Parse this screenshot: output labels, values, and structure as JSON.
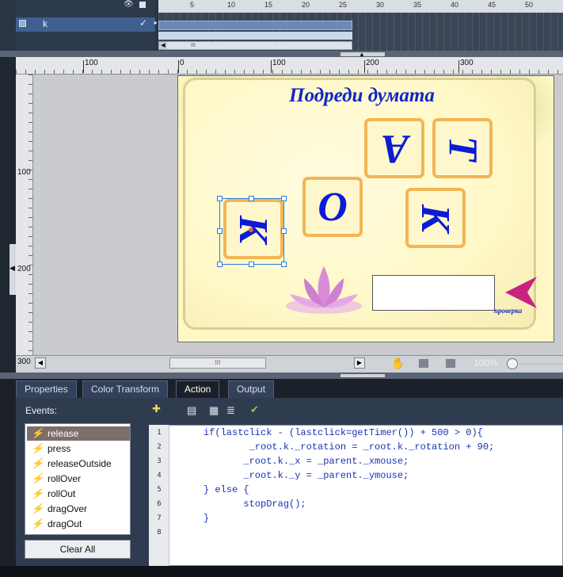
{
  "timeline": {
    "layer_name": "k",
    "ruler_numbers": [
      "5",
      "10",
      "15",
      "20",
      "25",
      "30",
      "35",
      "40",
      "45",
      "50"
    ],
    "scroll_label": "III"
  },
  "stage": {
    "ruler_top": [
      "100",
      "0",
      "100",
      "200",
      "300"
    ],
    "ruler_left": [
      "100",
      "200"
    ],
    "bottom_ruler": "300",
    "scroll_label": "III",
    "zoom": "100%"
  },
  "document": {
    "title": "Подреди думата",
    "tiles": [
      "К",
      "О",
      "А",
      "Т",
      "К"
    ],
    "check_label": "проверка"
  },
  "panel": {
    "tabs": [
      "Properties",
      "Color Transform",
      "Action",
      "Output"
    ],
    "active_tab": "Action",
    "events_label": "Events:",
    "events": [
      {
        "label": "release",
        "active": true,
        "selected": true
      },
      {
        "label": "press",
        "active": true,
        "selected": false
      },
      {
        "label": "releaseOutside",
        "active": false,
        "selected": false
      },
      {
        "label": "rollOver",
        "active": false,
        "selected": false
      },
      {
        "label": "rollOut",
        "active": false,
        "selected": false
      },
      {
        "label": "dragOver",
        "active": false,
        "selected": false
      },
      {
        "label": "dragOut",
        "active": false,
        "selected": false
      }
    ],
    "clear_all": "Clear All",
    "code_lines": [
      "if(lastclick - (lastclick=getTimer()) + 500 > 0){",
      "        _root.k._rotation = _root.k._rotation + 90;",
      "       _root.k._x = _parent._xmouse;",
      "       _root.k._y = _parent._ymouse;",
      "} else {",
      "       stopDrag();",
      "}",
      ""
    ],
    "line_numbers": [
      "1",
      "2",
      "3",
      "4",
      "5",
      "6",
      "7",
      "8"
    ]
  },
  "colors": {
    "accent_blue": "#1024c8",
    "tile_border": "#f3b555",
    "check_arrow": "#c8247f"
  }
}
